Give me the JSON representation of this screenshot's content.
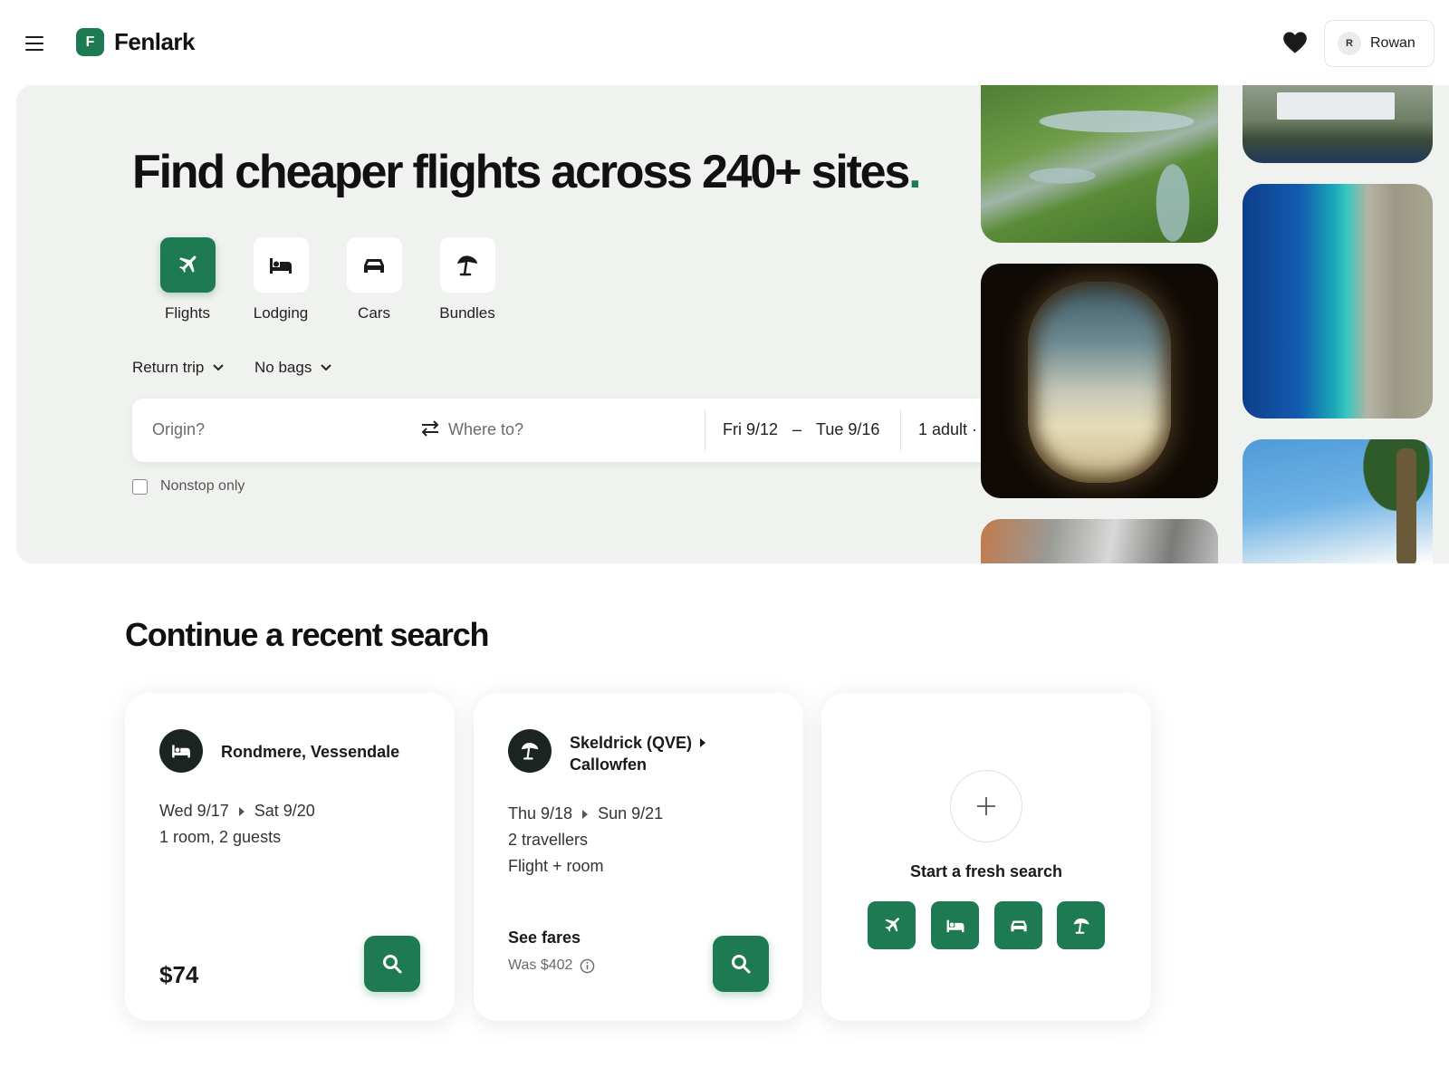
{
  "header": {
    "logo_letter": "F",
    "logo_text": "Fenlark",
    "user_initial": "R",
    "user_name": "Rowan"
  },
  "hero": {
    "title": "Find cheaper flights across 240+ sites",
    "title_dot": ".",
    "categories": [
      {
        "label": "Flights",
        "icon": "plane-icon",
        "active": true
      },
      {
        "label": "Lodging",
        "icon": "bed-icon",
        "active": false
      },
      {
        "label": "Cars",
        "icon": "car-icon",
        "active": false
      },
      {
        "label": "Bundles",
        "icon": "umbrella-icon",
        "active": false
      }
    ],
    "trip_type": "Return trip",
    "bags": "No bags",
    "search": {
      "origin_placeholder": "Origin?",
      "destination_placeholder": "Where to?",
      "depart_date": "Fri 9/12",
      "date_separator": "–",
      "return_date": "Tue 9/16",
      "travellers": "1 adult ·"
    },
    "nonstop_label": "Nonstop only"
  },
  "recent": {
    "title": "Continue a recent search",
    "cards": [
      {
        "icon": "bed-icon",
        "title": "Rondmere, Vessendale",
        "date_from": "Wed 9/17",
        "date_to": "Sat 9/20",
        "detail": "1 room, 2 guests",
        "price": "$74"
      },
      {
        "icon": "umbrella-icon",
        "title_line1": "Skeldrick (QVE)",
        "title_line2": "Callowfen",
        "date_from": "Thu 9/18",
        "date_to": "Sun 9/21",
        "detail1": "2 travellers",
        "detail2": "Flight + room",
        "see_fares": "See fares",
        "was_price": "Was $402"
      }
    ],
    "fresh": {
      "title": "Start a fresh search"
    }
  },
  "colors": {
    "brand": "#1e7a52",
    "hero_bg": "#eff2ee",
    "icon_dark": "#1c2421"
  }
}
